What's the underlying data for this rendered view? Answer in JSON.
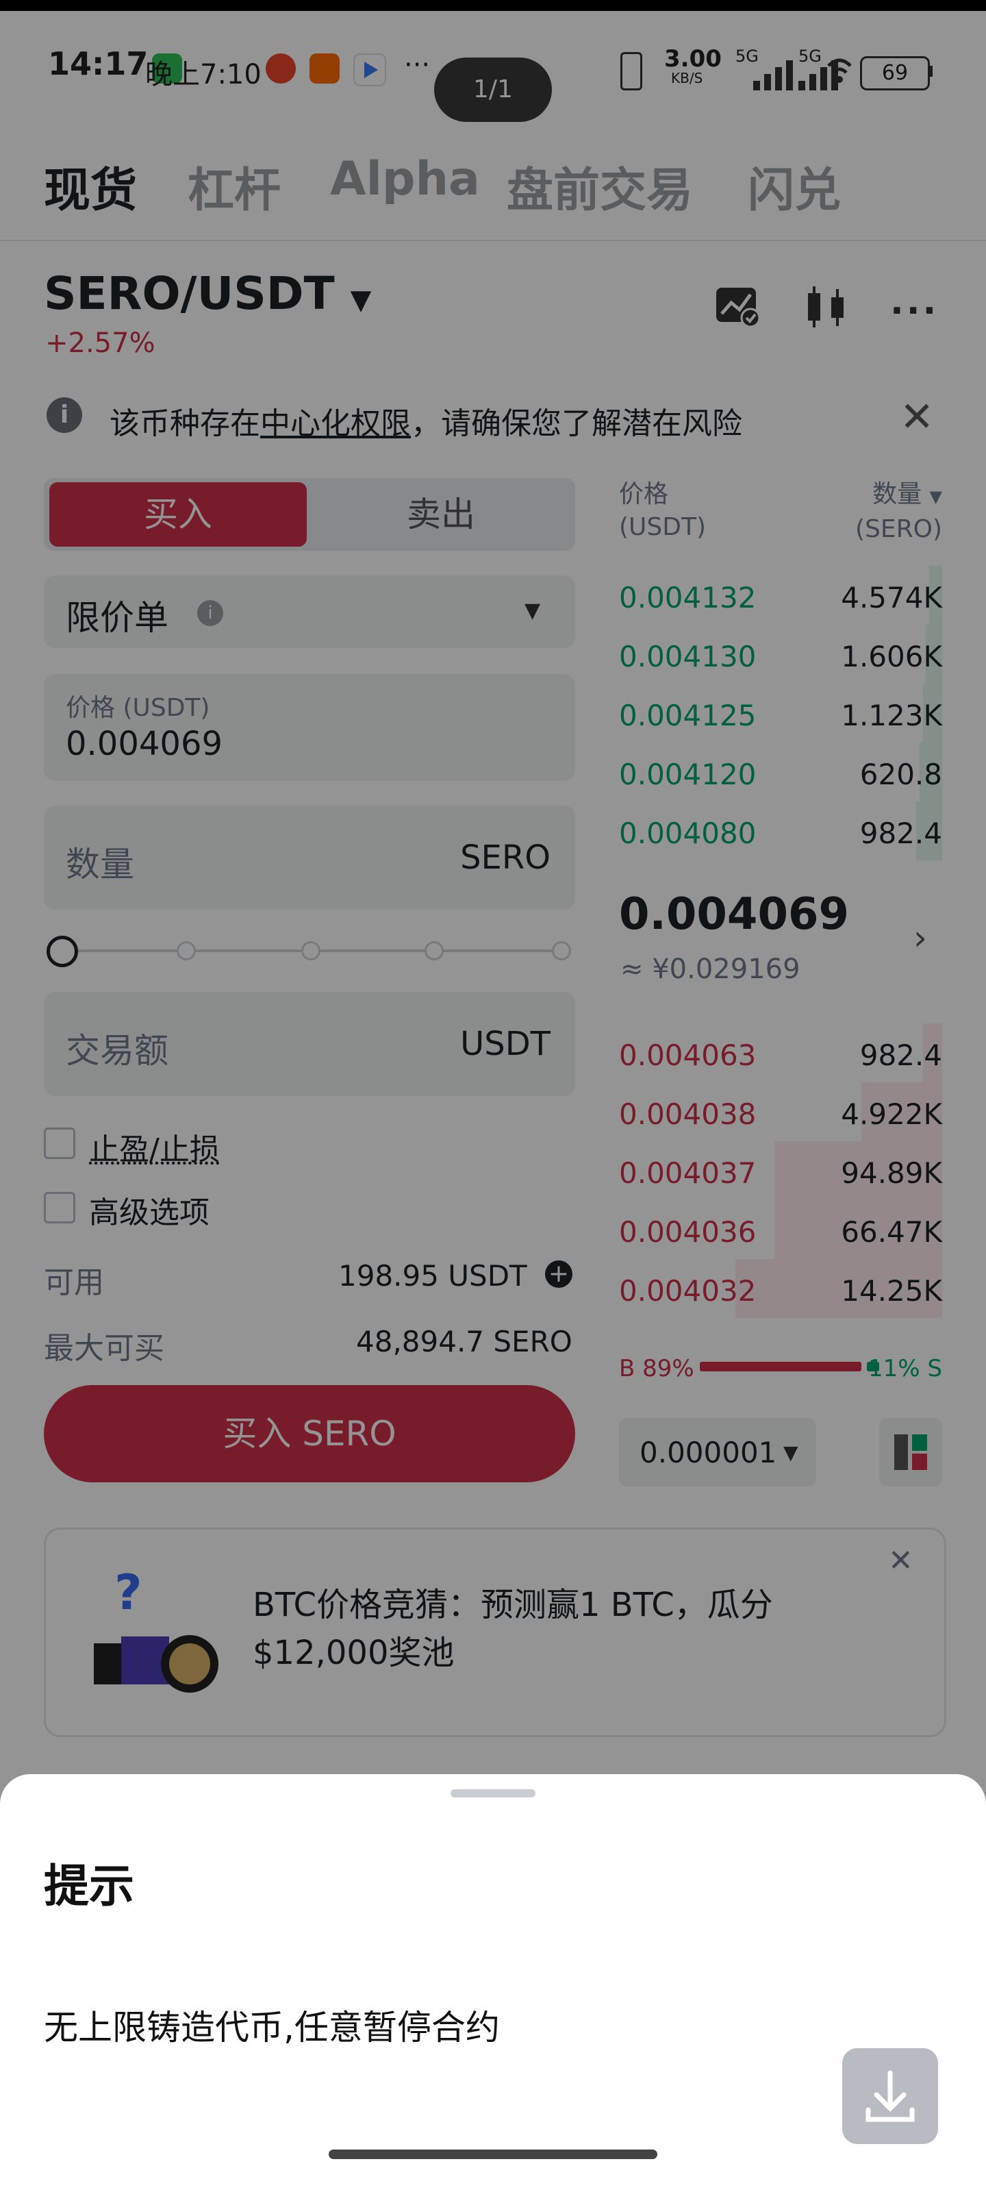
{
  "status_bar": {
    "time": "14:17",
    "notify_text": "晚上7:10",
    "more": "···",
    "net_speed": "3.00",
    "net_unit": "KB/S",
    "signal1": "5G",
    "signal2": "5G",
    "battery": "69"
  },
  "page_indicator": "1/1",
  "nav_tabs": [
    "现货",
    "杠杆",
    "Alpha",
    "盘前交易",
    "闪兑"
  ],
  "pair": {
    "name": "SERO/USDT",
    "change": "+2.57%"
  },
  "notice": {
    "prefix": "该币种存在",
    "link": "中心化权限",
    "suffix": "，请确保您了解潜在风险"
  },
  "order_form": {
    "buy_tab": "买入",
    "sell_tab": "卖出",
    "order_type": "限价单",
    "price_label": "价格 (USDT)",
    "price_value": "0.004069",
    "amount_label": "数量",
    "amount_unit": "SERO",
    "total_label": "交易额",
    "total_unit": "USDT",
    "tpsl_label": "止盈/止损",
    "advanced_label": "高级选项",
    "available_label": "可用",
    "available_value": "198.95 USDT",
    "maxbuy_label": "最大可买",
    "maxbuy_value": "48,894.7 SERO",
    "submit_label": "买入 SERO"
  },
  "orderbook": {
    "price_header": "价格",
    "price_unit": "(USDT)",
    "qty_header": "数量",
    "qty_unit": "(SERO)",
    "asks": [
      {
        "price": "0.004132",
        "qty": "4.574K",
        "depth": 0.04
      },
      {
        "price": "0.004130",
        "qty": "1.606K",
        "depth": 0.05
      },
      {
        "price": "0.004125",
        "qty": "1.123K",
        "depth": 0.06
      },
      {
        "price": "0.004120",
        "qty": "620.8",
        "depth": 0.07
      },
      {
        "price": "0.004080",
        "qty": "982.4",
        "depth": 0.08
      }
    ],
    "mid_price": "0.004069",
    "mid_cny": "≈ ¥0.029169",
    "bids": [
      {
        "price": "0.004063",
        "qty": "982.4",
        "depth": 0.06
      },
      {
        "price": "0.004038",
        "qty": "4.922K",
        "depth": 0.25
      },
      {
        "price": "0.004037",
        "qty": "94.89K",
        "depth": 0.52
      },
      {
        "price": "0.004036",
        "qty": "66.47K",
        "depth": 0.52
      },
      {
        "price": "0.004032",
        "qty": "14.25K",
        "depth": 0.64
      }
    ],
    "buy_ratio_label": "B 89%",
    "sell_ratio_label": "11% S",
    "buy_ratio": 0.89,
    "step": "0.000001"
  },
  "promo": {
    "text_line1": "BTC价格竞猜：预测赢1 BTC，瓜分",
    "text_line2": "$12,000奖池"
  },
  "sheet": {
    "title": "提示",
    "body": "无上限铸造代币,任意暂停合约"
  },
  "colors": {
    "buy": "#cf304a",
    "sell": "#03a66d"
  }
}
